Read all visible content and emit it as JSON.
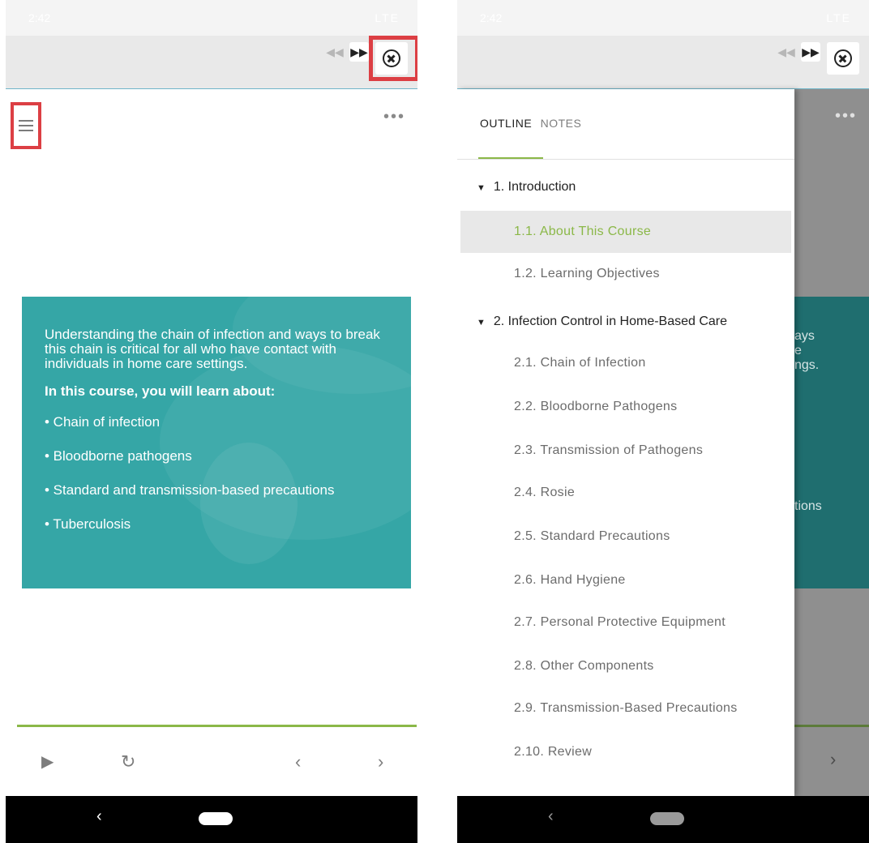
{
  "status_bar": {
    "time": "2:42",
    "indicators": "LTE"
  },
  "player_controls": {
    "rewind_icon": "fast-rewind-icon",
    "forward_icon": "fast-forward-icon",
    "close_icon": "close-circle-icon"
  },
  "slide": {
    "intro_text": "Understanding the chain of infection and ways to break this chain is critical for all who have contact with individuals in home care settings.",
    "heading": "In this course, you will learn about:",
    "bullets": [
      "• Chain of infection",
      "• Bloodborne pathogens",
      "• Standard and transmission-based precautions",
      "• Tuberculosis"
    ]
  },
  "bottom_controls": {
    "play_icon": "play-icon",
    "replay_icon": "replay-icon",
    "prev_icon": "chevron-left-icon",
    "next_icon": "chevron-right-icon"
  },
  "right_background": {
    "partial_text_1": "ays\ne\nngs.",
    "partial_text_2": "tions"
  },
  "drawer": {
    "tabs": [
      "OUTLINE",
      "NOTES"
    ],
    "sections": [
      {
        "label": "1. Introduction",
        "items": [
          "1.1. About This Course",
          "1.2. Learning Objectives"
        ]
      },
      {
        "label": "2. Infection Control in Home-Based Care",
        "items": [
          "2.1. Chain of Infection",
          "2.2. Bloodborne Pathogens",
          "2.3. Transmission of Pathogens",
          "2.4. Rosie",
          "2.5. Standard Precautions",
          "2.6. Hand Hygiene",
          "2.7. Personal Protective Equipment",
          "2.8. Other Components",
          "2.9. Transmission-Based Precautions",
          "2.10. Review"
        ]
      }
    ]
  },
  "colors": {
    "accent_green": "#8bb848",
    "slide_teal": "#35a6a6",
    "highlight_red": "#dc3f44"
  }
}
